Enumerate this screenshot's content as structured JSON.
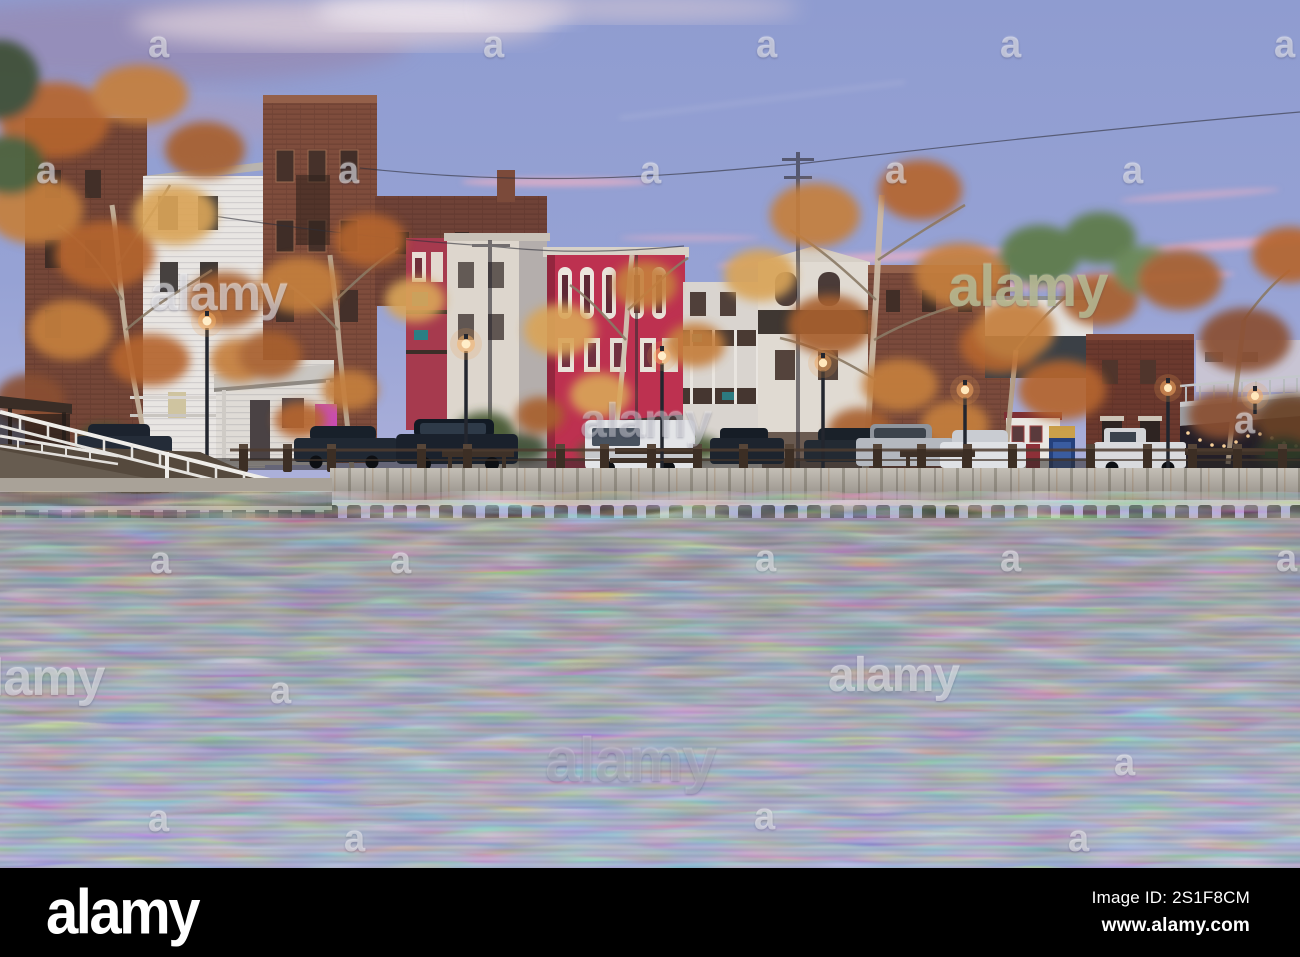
{
  "watermark": {
    "brand": "alamy",
    "letter": "a"
  },
  "footer": {
    "brand": "alamy",
    "image_id": "Image ID: 2S1F8CM",
    "website": "www.alamy.com"
  },
  "palette": {
    "sky_top": "#8F9ED2",
    "sky_horizon": "#BDBCDE",
    "cloud_dusk": "#968CB6",
    "cloud_pink": "#E3AFC6",
    "brick": "#7E4C3C",
    "brick_dark": "#6B392E",
    "clapboard_white": "#E8E5E2",
    "building_red": "#BD3150",
    "foliage_orange": "#C57F3D",
    "foliage_rust": "#A8602F",
    "lamp_glow": "#FFC97A",
    "seawall_concrete": "#B7B1A8",
    "water_top": "#82808C",
    "water_bottom": "#9FA9D2",
    "reflection_red": "#A23A52",
    "reflection_magenta": "#CF52BE",
    "footer_background": "#000000",
    "footer_text": "#FFFFFF"
  }
}
